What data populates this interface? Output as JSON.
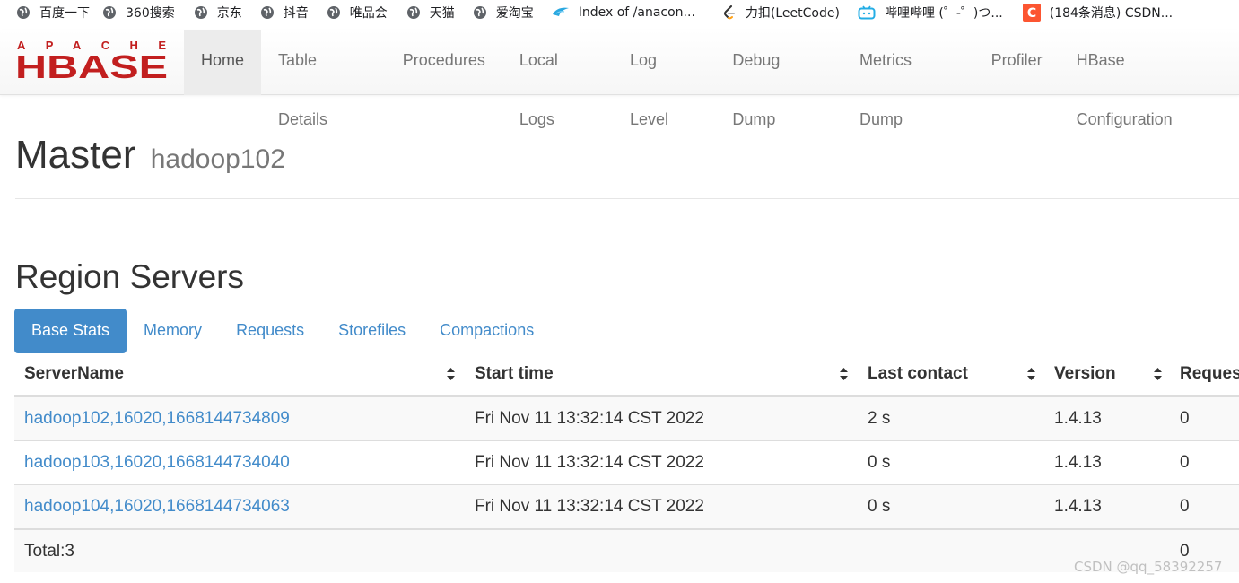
{
  "bookmarks": [
    {
      "label": "百度一下",
      "icon": "globe-icon"
    },
    {
      "label": "360搜索",
      "icon": "globe-icon"
    },
    {
      "label": "京东",
      "icon": "globe-icon"
    },
    {
      "label": "抖音",
      "icon": "globe-icon"
    },
    {
      "label": "唯品会",
      "icon": "globe-icon"
    },
    {
      "label": "天猫",
      "icon": "globe-icon"
    },
    {
      "label": "爱淘宝",
      "icon": "globe-icon"
    },
    {
      "label": "Index of /anacon...",
      "icon": "anaconda-icon"
    },
    {
      "label": "力扣(LeetCode)",
      "icon": "leetcode-icon"
    },
    {
      "label": "哔哩哔哩 (゜-゜)つ...",
      "icon": "bilibili-icon"
    },
    {
      "label": "(184条消息) CSDN...",
      "icon": "csdn-icon"
    }
  ],
  "brand": {
    "top": "APACHE",
    "main": "HBASE"
  },
  "nav": [
    {
      "label": "Home",
      "active": true
    },
    {
      "label": "Table Details"
    },
    {
      "label": "Procedures"
    },
    {
      "label": "Local Logs"
    },
    {
      "label": "Log Level"
    },
    {
      "label": "Debug Dump"
    },
    {
      "label": "Metrics Dump"
    },
    {
      "label": "Profiler"
    },
    {
      "label": "HBase Configuration"
    }
  ],
  "page": {
    "title": "Master",
    "subtitle": "hadoop102"
  },
  "region_servers": {
    "title": "Region Servers",
    "tabs": [
      "Base Stats",
      "Memory",
      "Requests",
      "Storefiles",
      "Compactions"
    ],
    "active_tab": "Base Stats",
    "columns": [
      "ServerName",
      "Start time",
      "Last contact",
      "Version",
      "Reques"
    ],
    "rows": [
      {
        "server": "hadoop102,16020,1668144734809",
        "start": "Fri Nov 11 13:32:14 CST 2022",
        "contact": "2 s",
        "version": "1.4.13",
        "requests": "0"
      },
      {
        "server": "hadoop103,16020,1668144734040",
        "start": "Fri Nov 11 13:32:14 CST 2022",
        "contact": "0 s",
        "version": "1.4.13",
        "requests": "0"
      },
      {
        "server": "hadoop104,16020,1668144734063",
        "start": "Fri Nov 11 13:32:14 CST 2022",
        "contact": "0 s",
        "version": "1.4.13",
        "requests": "0"
      }
    ],
    "total_label": "Total:3",
    "total_requests": "0"
  },
  "watermark": "CSDN @qq_58392257",
  "colors": {
    "accent": "#428bca",
    "brand_red": "#c21f1f",
    "text": "#333333"
  }
}
